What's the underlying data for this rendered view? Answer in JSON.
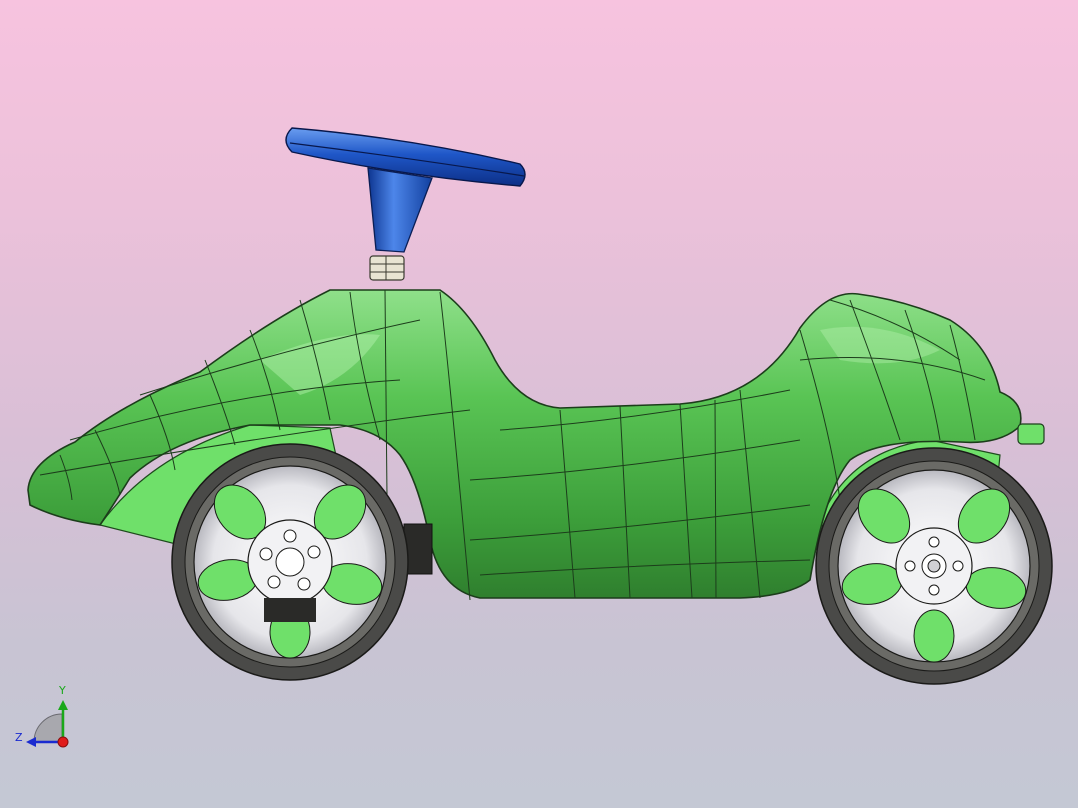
{
  "viewport": {
    "background_top": "#f7c3df",
    "background_bottom": "#c4c8d4"
  },
  "model": {
    "parts": [
      {
        "name": "body",
        "color": "#54c04f"
      },
      {
        "name": "steering-wheel",
        "color": "#1f57c8"
      },
      {
        "name": "wheel",
        "color": "#4a4a48"
      }
    ]
  },
  "triad": {
    "y_label": "Y",
    "z_label": "Z",
    "y_color": "#1aa81a",
    "z_color": "#1a2ad0",
    "x_color": "#e01b1b"
  }
}
